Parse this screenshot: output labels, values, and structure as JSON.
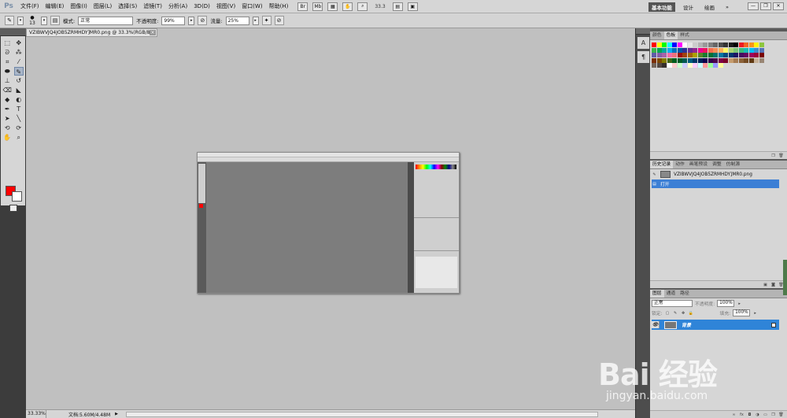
{
  "app": {
    "logo": "Ps"
  },
  "menu": [
    "文件(F)",
    "编辑(E)",
    "图像(I)",
    "图层(L)",
    "选择(S)",
    "滤镜(T)",
    "分析(A)",
    "3D(D)",
    "视图(V)",
    "窗口(W)",
    "帮助(H)"
  ],
  "menubar_tools": {
    "zoom": "33.3"
  },
  "workspaces": {
    "items": [
      "基本功能",
      "设计",
      "绘画"
    ],
    "more": "»"
  },
  "window_controls": [
    "—",
    "❐",
    "✕"
  ],
  "options": {
    "brush_size": "13",
    "mode_label": "模式:",
    "mode_value": "正常",
    "opacity_label": "不透明度:",
    "opacity_value": "99%",
    "flow_label": "流量:",
    "flow_value": "25%"
  },
  "document": {
    "tab_title": "VZIBWVJQ4JOB5ZRMHDY]MR0.png @ 33.3%(RGB/8)",
    "close": "×"
  },
  "statusbar": {
    "zoom": "33.33%",
    "doc_info": "文档:5.60M/4.48M",
    "arrow": "▶"
  },
  "dock": {
    "icons": [
      "A",
      "¶"
    ]
  },
  "swatches_panel": {
    "tabs": [
      "颜色",
      "色板",
      "样式"
    ],
    "colors": [
      "#ff0000",
      "#ffff00",
      "#00ff00",
      "#00ffff",
      "#0000ff",
      "#ff00ff",
      "#ffffff",
      "#e6e6e6",
      "#cccccc",
      "#b3b3b3",
      "#999999",
      "#808080",
      "#666666",
      "#4d4d4d",
      "#333333",
      "#1a1a1a",
      "#000000",
      "#ed1c24",
      "#f26522",
      "#f7941d",
      "#fff200",
      "#8dc63f",
      "#39b54a",
      "#00a651",
      "#00a99d",
      "#00aeef",
      "#0072bc",
      "#0054a6",
      "#2e3192",
      "#662d91",
      "#92278f",
      "#ec008c",
      "#ed145b",
      "#f26c4f",
      "#f68e56",
      "#fbaf5d",
      "#fff568",
      "#acd373",
      "#7cc576",
      "#3bb878",
      "#1abbb4",
      "#00bff3",
      "#438ccb",
      "#5574b9",
      "#605ca8",
      "#8560a8",
      "#a864a8",
      "#f06ea9",
      "#f0727c",
      "#9e0b0f",
      "#a0410d",
      "#a36209",
      "#aba000",
      "#598527",
      "#1a7b30",
      "#007236",
      "#00746b",
      "#0076a3",
      "#004b80",
      "#003471",
      "#1b1464",
      "#440e62",
      "#630460",
      "#9e005d",
      "#9e0039",
      "#790000",
      "#7b2e00",
      "#7d4900",
      "#827b00",
      "#406618",
      "#005e20",
      "#005826",
      "#005952",
      "#005b7f",
      "#003663",
      "#002157",
      "#0d004c",
      "#32004b",
      "#4b0049",
      "#7b0046",
      "#7a0026",
      "#c69c6d",
      "#a67c52",
      "#8c6239",
      "#754c24",
      "#603913",
      "#c7b299",
      "#998675",
      "#736357",
      "#534741",
      "#362f2d",
      "#ffffff",
      "#ffcccc",
      "#ccffcc",
      "#ccccff",
      "#ffffcc",
      "#ffccff",
      "#ccffff",
      "#ff9999",
      "#99ff99",
      "#9999ff",
      "#ffff99"
    ]
  },
  "history_panel": {
    "tabs": [
      "历史记录",
      "动作",
      "画笔预设",
      "调整",
      "仿制源"
    ],
    "snapshot": "VZIBWVJQ4JOB5ZRMHDY]MR0.png",
    "steps": [
      "打开"
    ]
  },
  "layers_panel": {
    "tabs": [
      "图层",
      "通道",
      "路径"
    ],
    "blend_mode": "正常",
    "opacity_label": "不透明度:",
    "opacity_value": "100%",
    "lock_label": "锁定:",
    "fill_label": "填充:",
    "fill_value": "100%",
    "layers": [
      {
        "name": "背景"
      }
    ]
  },
  "watermark": {
    "logo": "Bai 经验",
    "url": "jingyan.baidu.com"
  }
}
